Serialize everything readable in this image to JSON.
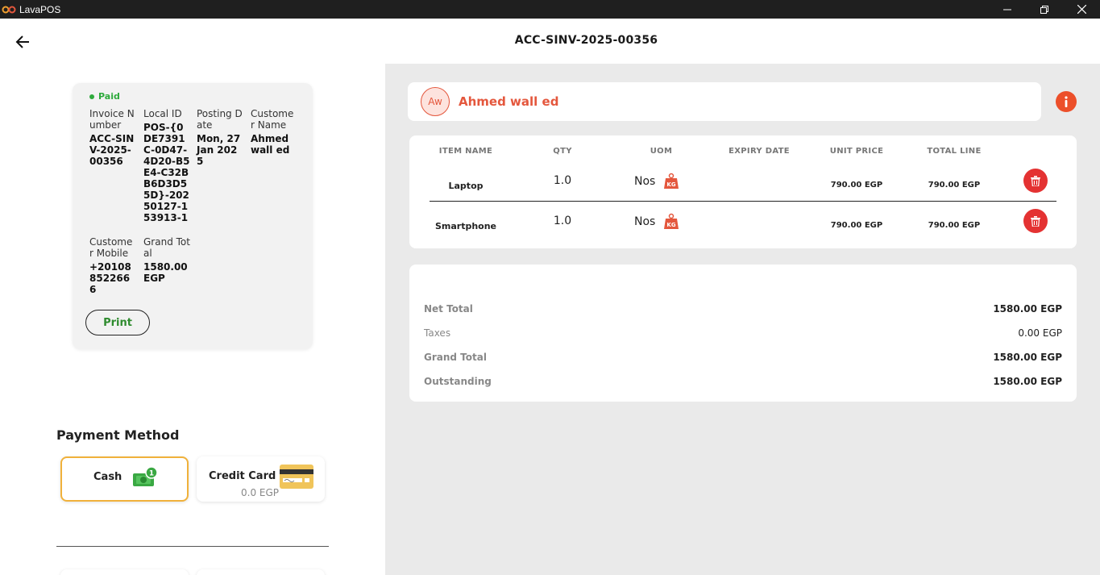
{
  "app": {
    "title": "LavaPOS",
    "minimize_glyph": "—",
    "close_glyph": "✕"
  },
  "header": {
    "title": "ACC-SINV-2025-00356",
    "back_icon": "arrow-left-icon"
  },
  "invoice": {
    "status": "Paid",
    "fields": {
      "invoice_number": {
        "label": "Invoice Number",
        "value": "ACC-SINV-2025-00356"
      },
      "local_id": {
        "label": "Local ID",
        "value": "POS-{0DE7391C-0D47-4D20-B5E4-C32BB6D3D55D}-20250127-153913-1"
      },
      "posting_date": {
        "label": "Posting Date",
        "value": "Mon, 27 Jan 2025"
      },
      "customer_name": {
        "label": "Customer Name",
        "value": "Ahmed wall ed"
      },
      "customer_mobile": {
        "label": "Customer Mobile",
        "value": "+201088522666"
      },
      "grand_total": {
        "label": "Grand Total",
        "value": "1580.00 EGP"
      }
    },
    "print_label": "Print"
  },
  "payment": {
    "title": "Payment Method",
    "methods": [
      {
        "label": "Cash",
        "badge": "1",
        "icon": "cash-icon",
        "selected": true
      },
      {
        "label": "Credit Card",
        "amount": "0.0 EGP",
        "icon": "credit-card-icon",
        "selected": false
      }
    ]
  },
  "customer": {
    "initials": "Aw",
    "name": "Ahmed wall ed",
    "info_icon": "info-icon"
  },
  "items_table": {
    "columns": [
      "ITEM NAME",
      "QTY",
      "UOM",
      "EXPIRY DATE",
      "UNIT PRICE",
      "TOTAL LINE"
    ],
    "rows": [
      {
        "name": "Laptop",
        "qty": "1.0",
        "uom": "Nos",
        "expiry": "",
        "unit_price": "790.00 EGP",
        "total": "790.00 EGP"
      },
      {
        "name": "Smartphone",
        "qty": "1.0",
        "uom": "Nos",
        "expiry": "",
        "unit_price": "790.00 EGP",
        "total": "790.00 EGP"
      }
    ]
  },
  "totals": {
    "net_total": {
      "label": "Net Total",
      "value": "1580.00 EGP"
    },
    "taxes": {
      "label": "Taxes",
      "value": "0.00 EGP"
    },
    "grand_total": {
      "label": "Grand Total",
      "value": "1580.00 EGP"
    },
    "outstanding": {
      "label": "Outstanding",
      "value": "1580.00 EGP"
    }
  },
  "colors": {
    "accent": "#e4573d",
    "paid": "#2eaa3c",
    "delete": "#e43232",
    "cash_border": "#f0b13b",
    "titlebar": "#1f1f1f",
    "panel": "#eaeaea"
  }
}
